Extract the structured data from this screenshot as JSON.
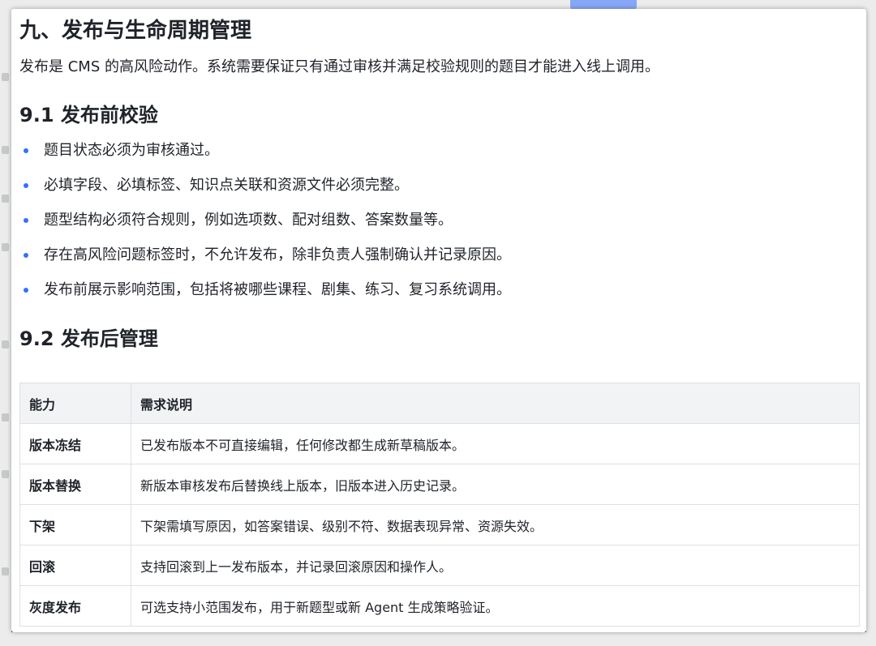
{
  "section": {
    "title": "九、发布与生命周期管理",
    "intro": "发布是 CMS 的高风险动作。系统需要保证只有通过审核并满足校验规则的题目才能进入线上调用。"
  },
  "pre_publish": {
    "heading": "9.1 发布前校验",
    "items": [
      "题目状态必须为审核通过。",
      "必填字段、必填标签、知识点关联和资源文件必须完整。",
      "题型结构必须符合规则，例如选项数、配对组数、答案数量等。",
      "存在高风险问题标签时，不允许发布，除非负责人强制确认并记录原因。",
      "发布前展示影响范围，包括将被哪些课程、剧集、练习、复习系统调用。"
    ]
  },
  "post_publish": {
    "heading": "9.2 发布后管理",
    "table": {
      "headers": [
        "能力",
        "需求说明"
      ],
      "rows": [
        [
          "版本冻结",
          "已发布版本不可直接编辑，任何修改都生成新草稿版本。"
        ],
        [
          "版本替换",
          "新版本审核发布后替换线上版本，旧版本进入历史记录。"
        ],
        [
          "下架",
          "下架需填写原因，如答案错误、级别不符、数据表现异常、资源失效。"
        ],
        [
          "回滚",
          "支持回滚到上一发布版本，并记录回滚原因和操作人。"
        ],
        [
          "灰度发布",
          "可选支持小范围发布，用于新题型或新 Agent 生成策略验证。"
        ]
      ]
    }
  },
  "colors": {
    "bullet": "#3370ff",
    "table_header_bg": "#f2f3f5",
    "border": "#dee0e3",
    "text": "#1f2329"
  }
}
